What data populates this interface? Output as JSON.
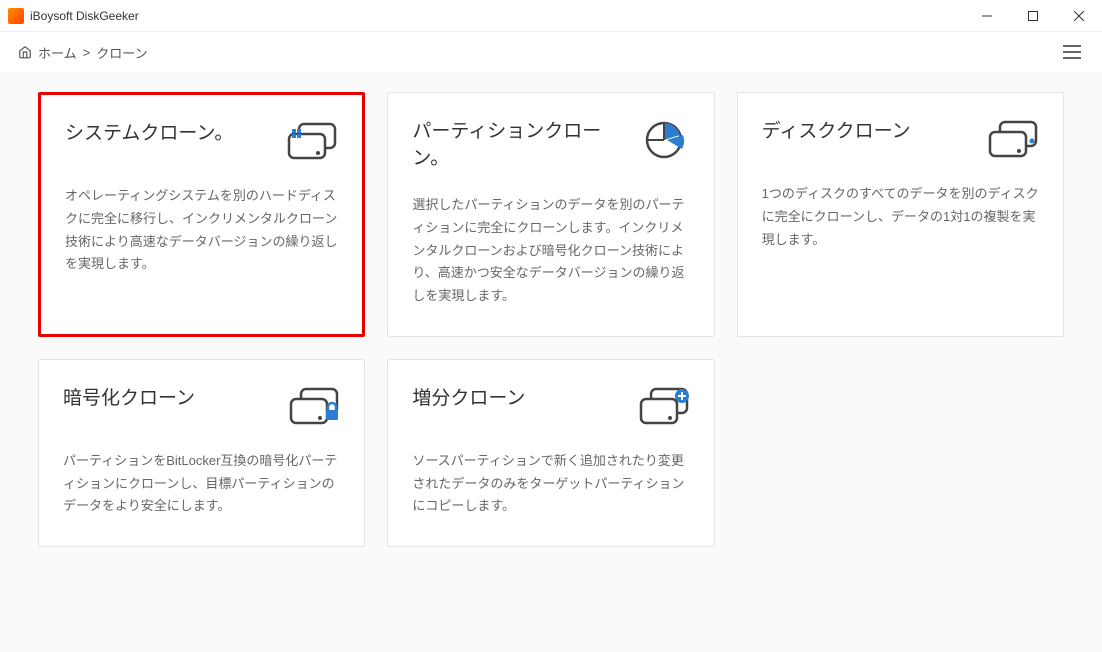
{
  "titlebar": {
    "title": "iBoysoft DiskGeeker"
  },
  "breadcrumb": {
    "home": "ホーム",
    "sep": ">",
    "current": "クローン"
  },
  "cards": [
    {
      "title": "システムクローン。",
      "desc": "オペレーティングシステムを別のハードディスクに完全に移行し、インクリメンタルクローン技術により高速なデータバージョンの繰り返しを実現します。"
    },
    {
      "title": "パーティションクローン。",
      "desc": "選択したパーティションのデータを別のパーティションに完全にクローンします。インクリメンタルクローンおよび暗号化クローン技術により、高速かつ安全なデータバージョンの繰り返しを実現します。"
    },
    {
      "title": "ディスククローン",
      "desc": "1つのディスクのすべてのデータを別のディスクに完全にクローンし、データの1対1の複製を実現します。"
    },
    {
      "title": "暗号化クローン",
      "desc": "パーティションをBitLocker互換の暗号化パーティションにクローンし、目標パーティションのデータをより安全にします。"
    },
    {
      "title": "増分クローン",
      "desc": "ソースパーティションで新く追加されたり変更されたデータのみをターゲットパーティションにコピーします。"
    }
  ]
}
